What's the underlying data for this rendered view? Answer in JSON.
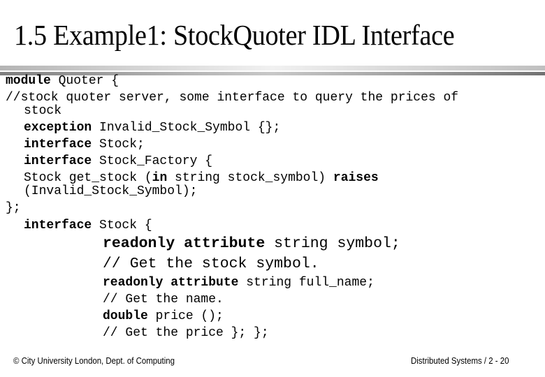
{
  "slide": {
    "title": "1.5 Example1:  StockQuoter IDL Interface",
    "code_lines": [
      {
        "kw": "module",
        "rest": " Quoter {"
      },
      {
        "kw": "",
        "rest": "//stock quoter server, some interface to query the prices of"
      },
      {
        "kw": "",
        "rest": "stock"
      },
      {
        "kw": "exception",
        "rest": " Invalid_Stock_Symbol {};"
      },
      {
        "kw": "interface",
        "rest": " Stock;"
      },
      {
        "kw": "interface",
        "rest": " Stock_Factory {"
      },
      {
        "pre": "Stock get_stock (",
        "kw": "in",
        "mid": " string stock_symbol) ",
        "kw2": "raises"
      },
      {
        "kw": "",
        "rest": "(Invalid_Stock_Symbol);"
      },
      {
        "kw": "",
        "rest": "};"
      },
      {
        "kw": "interface",
        "rest": " Stock {"
      },
      {
        "kw": "readonly attribute",
        "rest": " string symbol;"
      },
      {
        "kw": "",
        "rest": "// Get the stock symbol."
      },
      {
        "kw": "readonly attribute",
        "rest": " string full_name;"
      },
      {
        "kw": "",
        "rest": "// Get the name."
      },
      {
        "kw": "double",
        "rest": " price ();"
      },
      {
        "kw": "",
        "rest": "// Get the price }; };"
      }
    ]
  },
  "footer": {
    "left": "© City University London, Dept. of Computing",
    "right": "Distributed Systems / 2 - 20"
  }
}
